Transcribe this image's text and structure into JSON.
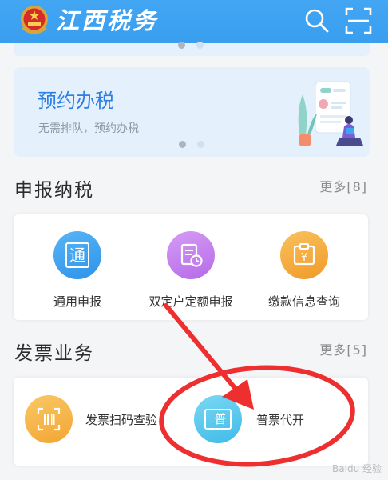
{
  "header": {
    "title": "江西税务",
    "icons": {
      "emblem": "national-emblem-icon",
      "search": "search-icon",
      "scan": "scan-icon"
    },
    "bg_color": "#3ea3f2"
  },
  "banner": {
    "title": "预约办税",
    "subtitle": "无需排队，预约办税",
    "art": "appointment-illustration",
    "active_slide": 1,
    "slides": 2
  },
  "sections": {
    "declare": {
      "title": "申报纳税",
      "more": "更多[8]",
      "items": [
        {
          "label": "通用申报",
          "icon": "通",
          "icon_name": "general-declare-icon",
          "color": "#3da4f0"
        },
        {
          "label": "双定户定额申报",
          "icon": "doc-clock",
          "icon_name": "quota-declare-icon",
          "color": "#c77ff0"
        },
        {
          "label": "缴款信息查询",
          "icon": "yen-doc",
          "icon_name": "payment-query-icon",
          "color": "#f6ac3b"
        }
      ]
    },
    "invoice": {
      "title": "发票业务",
      "more": "更多[5]",
      "items": [
        {
          "label": "发票扫码查验",
          "icon_name": "invoice-scan-icon",
          "color": "#f6b343"
        },
        {
          "label": "普票代开",
          "icon": "普",
          "icon_name": "general-invoice-icon",
          "color": "#57c9ee"
        }
      ]
    }
  },
  "annotation": {
    "color": "#ef2f2f"
  },
  "watermark": "Baidu 经验"
}
